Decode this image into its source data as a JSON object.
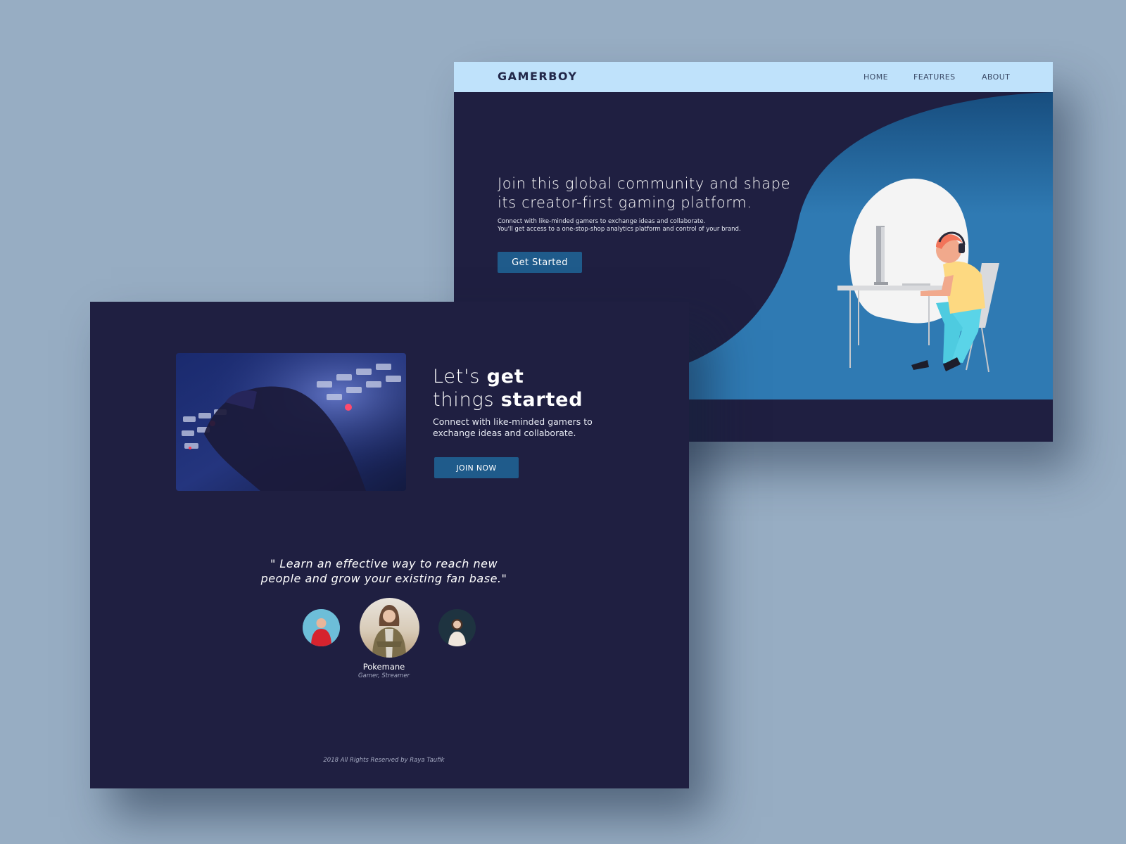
{
  "hero_page": {
    "brand": "GAMERBOY",
    "nav": {
      "home": "HOME",
      "features": "FEATURES",
      "about": "ABOUT"
    },
    "title_line1": "Join this global community and shape",
    "title_line2": "its creator-first gaming platform.",
    "desc_line1": "Connect with like-minded gamers to exchange ideas and collaborate.",
    "desc_line2": "You'll get access to a one-stop-shop analytics platform and control of your brand.",
    "cta_label": "Get Started"
  },
  "content_page": {
    "heading": {
      "part1": "Let's ",
      "part2": "get",
      "part3": "things ",
      "part4": "started"
    },
    "desc_line1": "Connect with like-minded gamers to",
    "desc_line2": "exchange ideas and collaborate.",
    "join_label": "JOIN NOW",
    "quote_line1": "\" Learn an effective way to reach new",
    "quote_line2": "people and grow your existing fan base.\"",
    "testimonial": {
      "name": "Pokemane",
      "role": "Gamer, Streamer"
    },
    "footer": "2018 All Rights Reserved by Raya Taufik"
  },
  "colors": {
    "background": "#97adc3",
    "page_bg": "#1f1f41",
    "navbar_bg": "#bfe2fb",
    "button_bg": "#1f5b8b",
    "hero_blue": "#2f7ab3"
  }
}
